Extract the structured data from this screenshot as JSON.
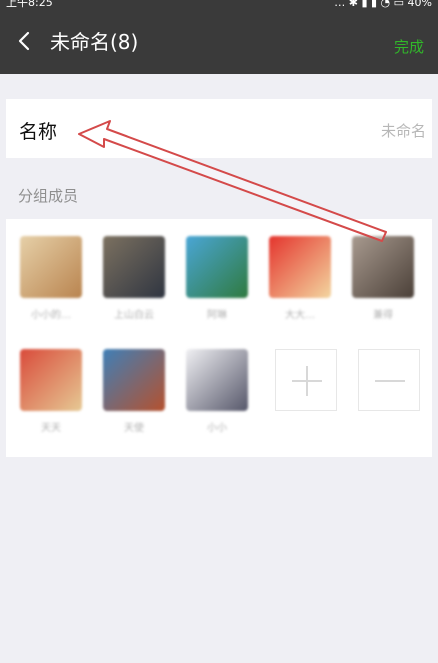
{
  "status_bar": {
    "time": "上午8:25",
    "indicators": "… ✱ ▮ ▮ ◔ ▭ 40%"
  },
  "header": {
    "back_icon": "chevron-left-icon",
    "title": "未命名(8)",
    "done_label": "完成",
    "accent": "#31b62a"
  },
  "name_field": {
    "label": "名称",
    "value": "未命名"
  },
  "members_section": {
    "title": "分组成员",
    "members": [
      {
        "name": "小小的…",
        "colors": [
          "#e6d0a8",
          "#b9844f"
        ]
      },
      {
        "name": "上山白云",
        "colors": [
          "#7c7160",
          "#2f3541"
        ]
      },
      {
        "name": "阿琳",
        "colors": [
          "#4aa6d6",
          "#2f7a3f"
        ]
      },
      {
        "name": "大大…",
        "colors": [
          "#e4342d",
          "#f3d6a0"
        ]
      },
      {
        "name": "兼得",
        "colors": [
          "#a89a8f",
          "#4b4038"
        ]
      },
      {
        "name": "天天",
        "colors": [
          "#d94b3b",
          "#e6c994"
        ]
      },
      {
        "name": "天使",
        "colors": [
          "#3f7fb7",
          "#b5512e"
        ]
      },
      {
        "name": "小小",
        "colors": [
          "#f0f0f3",
          "#56576a"
        ]
      }
    ],
    "add_icon": "plus-icon",
    "remove_icon": "minus-icon"
  }
}
